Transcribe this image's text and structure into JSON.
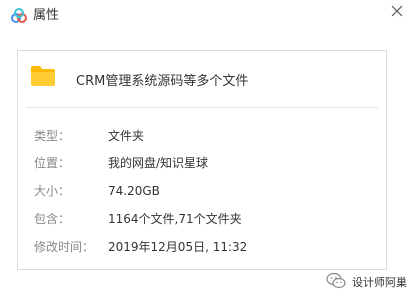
{
  "window": {
    "title": "属性",
    "logo_icon": "baidu-netdisk-cloud-icon",
    "close_icon": "close-icon",
    "accent_color": "#4a8ef6"
  },
  "file": {
    "icon": "folder-icon",
    "icon_color": "#ffc107",
    "name": "CRM管理系统源码等多个文件"
  },
  "properties": [
    {
      "label": "类型：",
      "value": "文件夹"
    },
    {
      "label": "位置：",
      "value": "我的网盘/知识星球"
    },
    {
      "label": "大小：",
      "value": "74.20GB"
    },
    {
      "label": "包含：",
      "value": "1164个文件,71个文件夹"
    },
    {
      "label": "修改时间：",
      "value": "2019年12月05日, 11:32"
    }
  ],
  "watermark": {
    "icon": "wechat-icon",
    "text": "设计师阿巢"
  }
}
